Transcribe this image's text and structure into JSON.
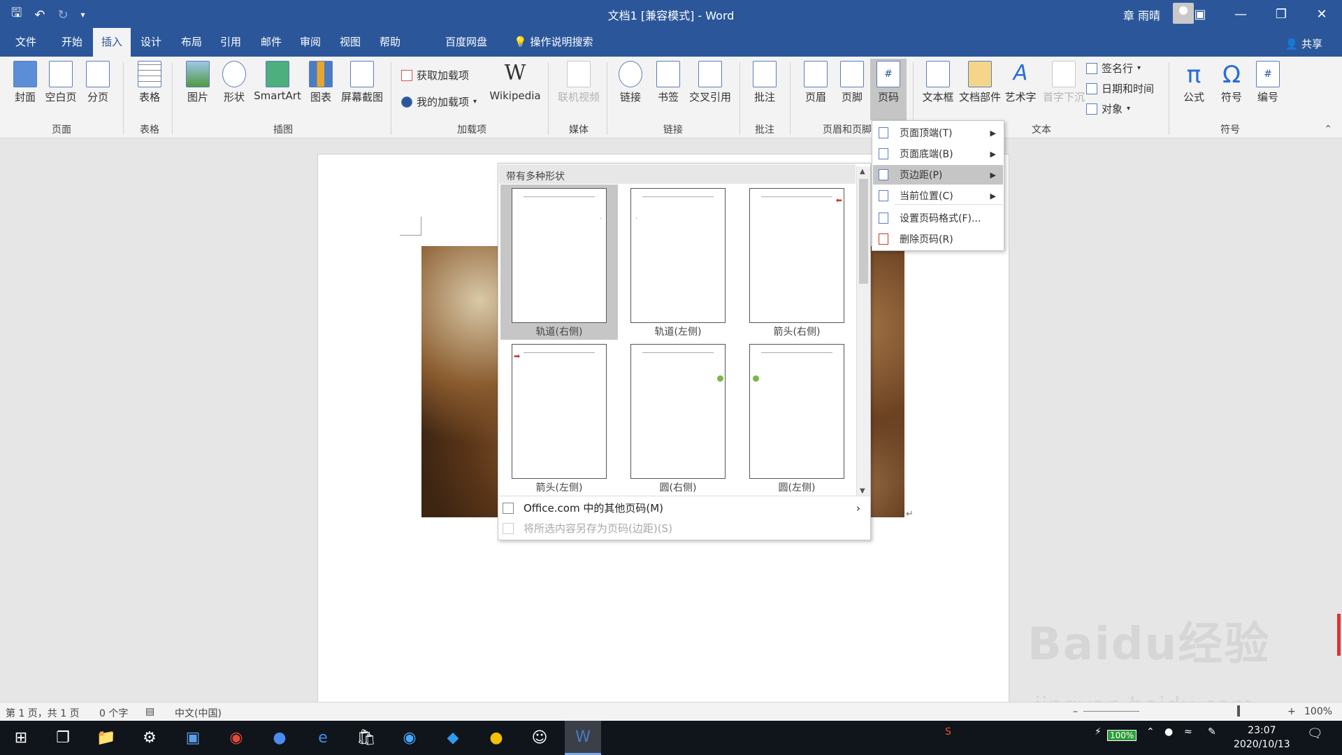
{
  "window": {
    "title": "文档1 [兼容模式]  -  Word",
    "user": "章 雨晴",
    "share": "共享"
  },
  "tabs": [
    "文件",
    "开始",
    "插入",
    "设计",
    "布局",
    "引用",
    "邮件",
    "审阅",
    "视图",
    "帮助",
    "百度网盘",
    "操作说明搜索"
  ],
  "ribbon": {
    "pages": [
      "封面",
      "空白页",
      "分页"
    ],
    "table": "表格",
    "illustrations": [
      "图片",
      "形状",
      "SmartArt",
      "图表",
      "屏幕截图"
    ],
    "addins": {
      "get": "获取加载项",
      "mine": "我的加载项",
      "wiki": "Wikipedia"
    },
    "media": "联机视频",
    "links": [
      "链接",
      "书签",
      "交叉引用"
    ],
    "comment": "批注",
    "header_footer": [
      "页眉",
      "页脚",
      "页码"
    ],
    "text": [
      "文本框",
      "文档部件",
      "艺术字",
      "首字下沉"
    ],
    "text_small": [
      "签名行",
      "日期和时间",
      "对象"
    ],
    "symbols": [
      "公式",
      "符号",
      "编号"
    ],
    "groups": [
      "页面",
      "表格",
      "插图",
      "加载项",
      "媒体",
      "链接",
      "批注",
      "页眉和页脚",
      "文本",
      "符号"
    ]
  },
  "gallery": {
    "header": "带有多种形状",
    "items": [
      "轨道(右侧)",
      "轨道(左侧)",
      "箭头(右侧)",
      "箭头(左侧)",
      "圆(右侧)",
      "圆(左侧)"
    ],
    "footer": [
      "Office.com 中的其他页码(M)",
      "将所选内容另存为页码(边距)(S)"
    ]
  },
  "menu": [
    "页面顶端(T)",
    "页面底端(B)",
    "页边距(P)",
    "当前位置(C)",
    "设置页码格式(F)...",
    "删除页码(R)"
  ],
  "status": {
    "page": "第 1 页，共 1 页",
    "words": "0 个字",
    "lang": "中文(中国)",
    "zoom": "100%"
  },
  "taskbar": {
    "time": "23:07",
    "date": "2020/10/13",
    "battery": "100%"
  },
  "watermark": {
    "main": "Baidu经验",
    "sub": "jingyan.baidu.com"
  },
  "colors": {
    "brand": "#2b579a",
    "marker_red": "#c0392b",
    "marker_green": "#7ab648"
  }
}
